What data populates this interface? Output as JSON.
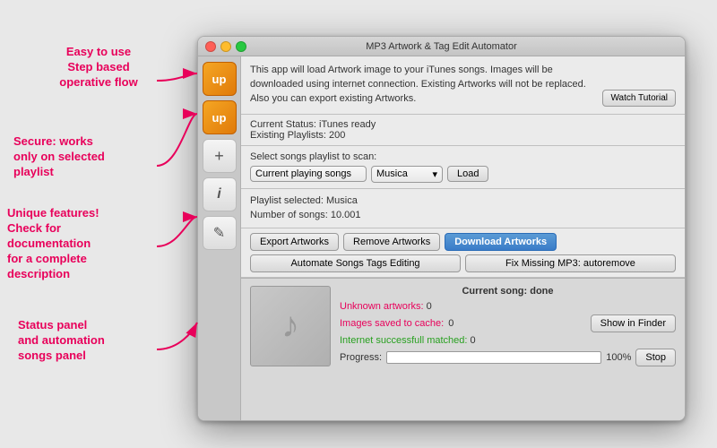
{
  "window": {
    "title": "MP3 Artwork & Tag Edit Automator",
    "titlebar": {
      "close": "close",
      "minimize": "minimize",
      "maximize": "maximize"
    }
  },
  "top_panel": {
    "description": "This app will load Artwork image to your iTunes songs. Images will be downloaded using internet connection. Existing Artworks will not be replaced. Also you can export existing Artworks.",
    "watch_tutorial": "Watch Tutorial"
  },
  "status_panel": {
    "line1": "Current Status: iTunes ready",
    "line2": "Existing Playlists: 200"
  },
  "playlist_panel": {
    "label": "Select songs playlist to scan:",
    "current_playing": "Current playing songs",
    "musica": "Musica",
    "load_btn": "Load"
  },
  "info_panel": {
    "line1": "Playlist selected: Musica",
    "line2": "Number of songs: 10.001"
  },
  "actions": {
    "export_artworks": "Export Artworks",
    "remove_artworks": "Remove Artworks",
    "download_artworks": "Download Artworks",
    "automate_tags": "Automate Songs Tags Editing",
    "fix_missing": "Fix Missing MP3: autoremove"
  },
  "bottom_status": {
    "current_song_label": "Current song: done",
    "unknown_artworks_label": "Unknown artworks: ",
    "unknown_artworks_value": "0",
    "images_saved_label": "Images saved to cache: ",
    "images_saved_value": "0",
    "internet_matched_label": "Internet successfull matched: ",
    "internet_matched_value": "0",
    "show_finder_btn": "Show in Finder",
    "progress_label": "Progress:",
    "progress_value": "100%",
    "stop_btn": "Stop"
  },
  "annotations": {
    "top_left": "Easy to use\nStep based\noperative flow",
    "mid_left1": "Secure: works\nonly on selected\nplaylist",
    "mid_left2": "Unique features!\nCheck for\ndocumentation\nfor a complete\ndescription",
    "bottom_left": "Status panel\nand automation\nsongs panel"
  },
  "sidebar_icons": {
    "icon1": "up",
    "icon2": "up",
    "icon3": "+",
    "icon4": "i",
    "icon5": "✎"
  }
}
